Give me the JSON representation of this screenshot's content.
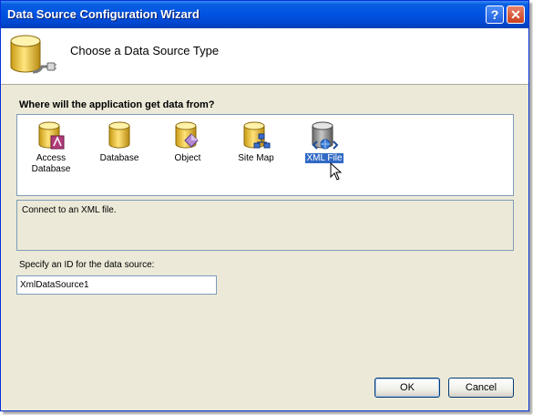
{
  "window": {
    "title": "Data Source Configuration Wizard"
  },
  "titlebar": {
    "help_label": "?",
    "close_label": "✕"
  },
  "header": {
    "title": "Choose a Data Source Type",
    "icon": "database-plug-icon"
  },
  "question": "Where will the application get data from?",
  "types": [
    {
      "label": "Access\nDatabase",
      "icon": "access-database-icon",
      "selected": false
    },
    {
      "label": "Database",
      "icon": "database-icon",
      "selected": false
    },
    {
      "label": "Object",
      "icon": "object-icon",
      "selected": false
    },
    {
      "label": "Site Map",
      "icon": "site-map-icon",
      "selected": false
    },
    {
      "label": "XML File",
      "icon": "xml-file-icon",
      "selected": true
    }
  ],
  "description": "Connect to an XML file.",
  "id_field": {
    "label": "Specify an ID for the data source:",
    "value": "XmlDataSource1"
  },
  "buttons": {
    "ok": "OK",
    "cancel": "Cancel"
  },
  "colors": {
    "titlebar": "#0054e3",
    "selection": "#316ac5",
    "face": "#ece9d8",
    "db_gold": "#f2c63a"
  }
}
